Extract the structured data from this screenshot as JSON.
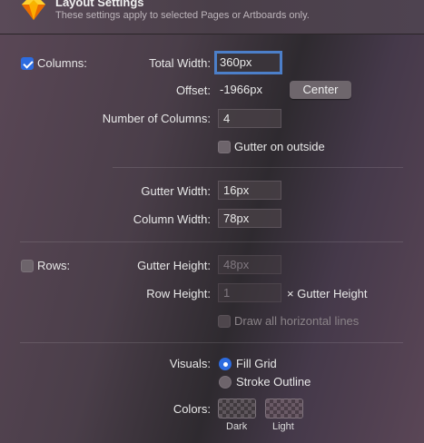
{
  "header": {
    "title": "Layout Settings",
    "subtitle": "These settings apply to selected Pages or Artboards only.",
    "icon": "sketch-diamond-icon"
  },
  "columns": {
    "checkbox_label": "Columns:",
    "checked": true,
    "total_width_label": "Total Width:",
    "total_width_value": "360px",
    "offset_label": "Offset:",
    "offset_value": "-1966px",
    "center_button": "Center",
    "number_label": "Number of Columns:",
    "number_value": "4",
    "gutter_outside_label": "Gutter on outside",
    "gutter_outside_checked": false,
    "gutter_width_label": "Gutter Width:",
    "gutter_width_value": "16px",
    "column_width_label": "Column Width:",
    "column_width_value": "78px"
  },
  "rows": {
    "checkbox_label": "Rows:",
    "checked": false,
    "gutter_height_label": "Gutter Height:",
    "gutter_height_placeholder": "48px",
    "row_height_label": "Row Height:",
    "row_height_placeholder": "1",
    "row_height_suffix": "× Gutter Height",
    "draw_lines_label": "Draw all horizontal lines"
  },
  "visuals": {
    "label": "Visuals:",
    "options": [
      "Fill Grid",
      "Stroke Outline"
    ],
    "selected": "Fill Grid"
  },
  "colors": {
    "label": "Colors:",
    "dark_label": "Dark",
    "light_label": "Light"
  },
  "accent_color": "#2d6ce0",
  "focus_color": "#4c7fc9"
}
